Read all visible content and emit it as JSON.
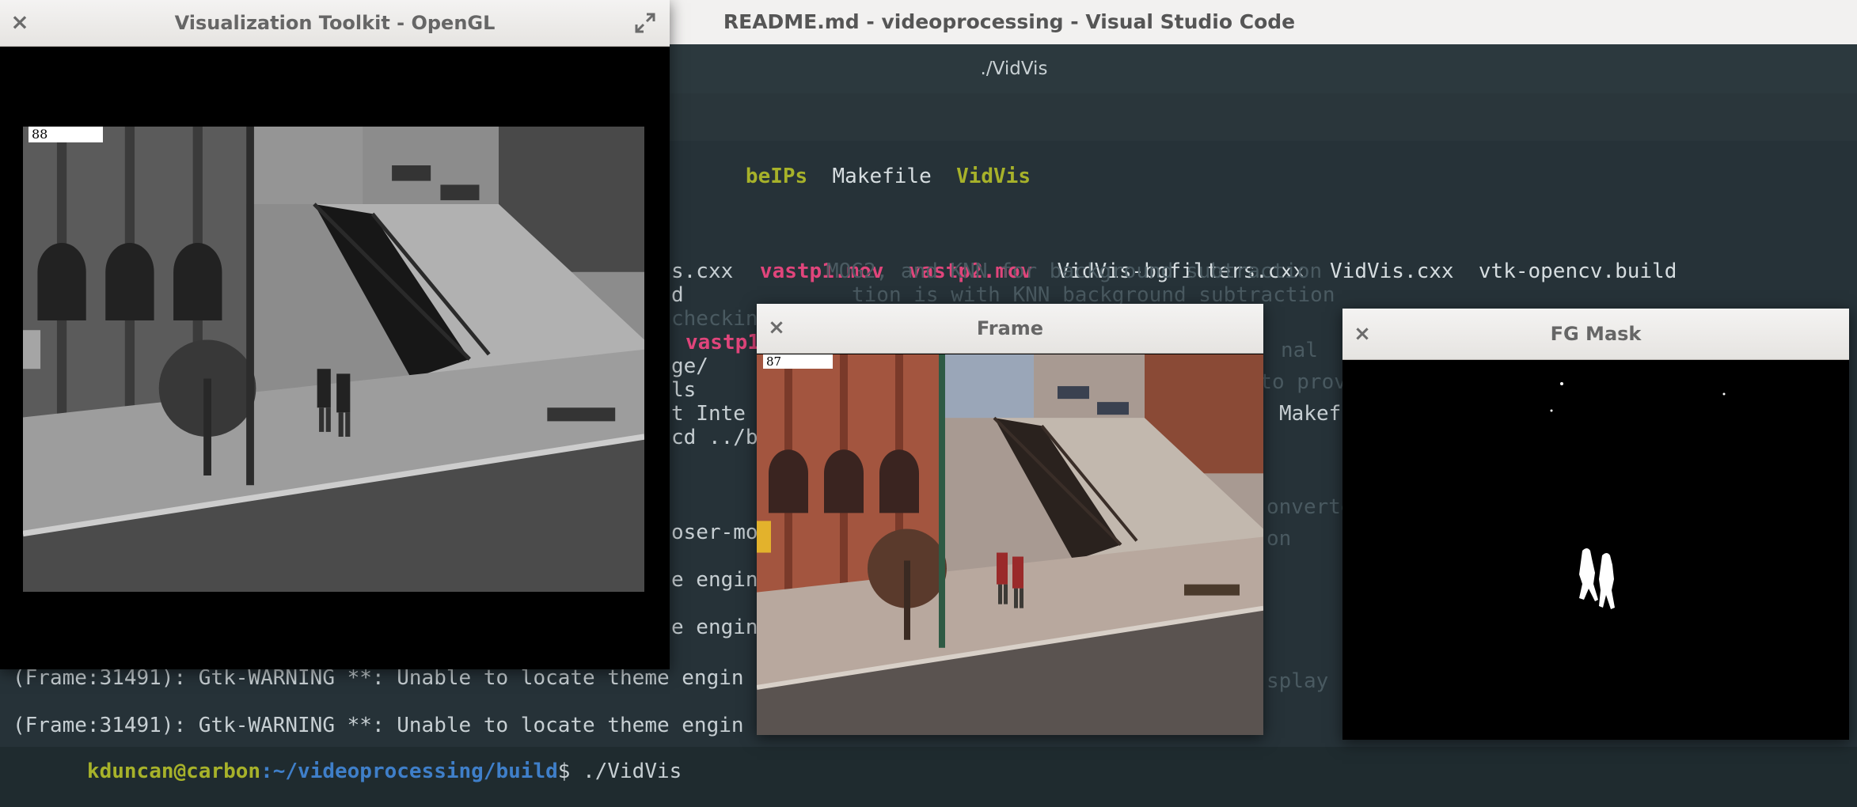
{
  "vscode": {
    "title": "README.md - videoprocessing - Visual Studio Code",
    "terminal_title": "./VidVis"
  },
  "terminal": {
    "row1": {
      "a": "beIPs",
      "b": "Makefile",
      "c": "VidVis"
    },
    "row2": {
      "a": "vastp1.mov",
      "b": "vastp2.mov",
      "c": "VidVis-bgfilters.cxx",
      "d": "VidVis.cxx",
      "e": "vtk-opencv.build"
    },
    "ghost_lines": {
      "g1": "MOG2, and KNN for background subtraction",
      "g2": "tion is with KNN background subtraction",
      "g3": "checking ran",
      "g4": "nal",
      "g5": "g to prover",
      "g6": "onverte",
      "g7": "on",
      "g8": "splay"
    },
    "frag": {
      "f1": "s.cxx",
      "f2": "d",
      "f3": "vastp1",
      "f4": "ge/",
      "f5": "ls",
      "f6": "t Inte",
      "f7": "Makef",
      "f8": "cd ../b",
      "f9": "oser-mo",
      "f10": "e engin",
      "f11": "e engin"
    },
    "warning1": "(Frame:31491): Gtk-WARNING **: Unable to locate theme engin",
    "warning2": "(Frame:31491): Gtk-WARNING **: Unable to locate theme engin",
    "prompt_user": "kduncan@carbon",
    "prompt_path": ":~/videoprocessing/build",
    "prompt_cmd": "$ ./VidVis"
  },
  "vtk_window": {
    "title": "Visualization Toolkit - OpenGL",
    "frame_number": "88"
  },
  "frame_window": {
    "title": "Frame",
    "frame_number": "87"
  },
  "fgmask_window": {
    "title": "FG Mask"
  },
  "icons": {
    "close": "×",
    "expand": "expand-icon"
  },
  "colors": {
    "terminal_bg": "#263238",
    "olive_dir": "#a7b22a",
    "pink_media": "#e0457b"
  }
}
